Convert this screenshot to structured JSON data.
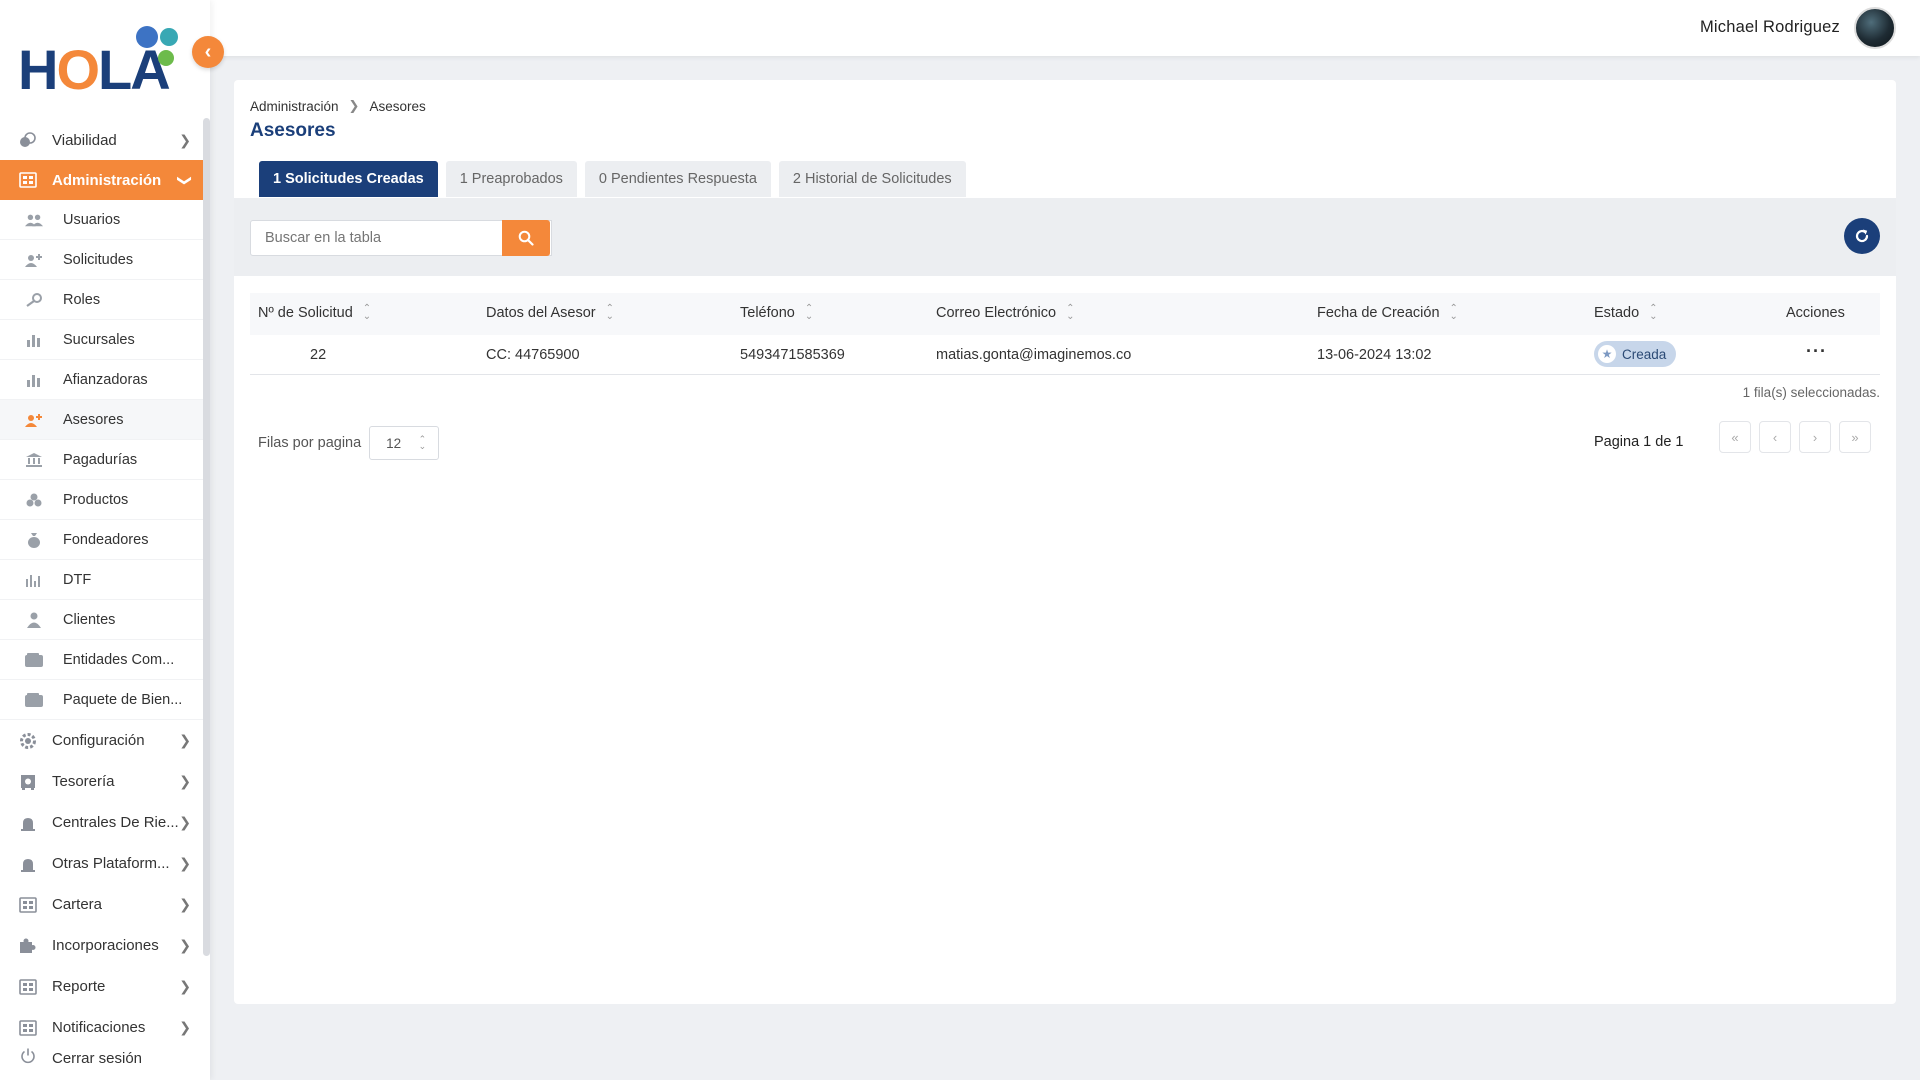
{
  "brand": {
    "logo_text": "HOLA",
    "colors": {
      "primary": "#1b3f7a",
      "accent": "#f4883a",
      "dot_blue": "#3d73c4",
      "dot_teal": "#38a8b4",
      "dot_green": "#6dbb4b"
    }
  },
  "header": {
    "user_name": "Michael Rodriguez"
  },
  "sidebar": {
    "items_top": [
      {
        "label": "Viabilidad",
        "icon": "coins-icon"
      }
    ],
    "active_section": {
      "label": "Administración",
      "icon": "grid-icon"
    },
    "sub_items": [
      {
        "label": "Usuarios",
        "icon": "users-icon"
      },
      {
        "label": "Solicitudes",
        "icon": "user-plus-icon"
      },
      {
        "label": "Roles",
        "icon": "key-icon"
      },
      {
        "label": "Sucursales",
        "icon": "chart-icon"
      },
      {
        "label": "Afianzadoras",
        "icon": "chart-icon"
      },
      {
        "label": "Asesores",
        "icon": "user-plus-icon"
      },
      {
        "label": "Pagadurías",
        "icon": "bank-icon"
      },
      {
        "label": "Productos",
        "icon": "boxes-icon"
      },
      {
        "label": "Fondeadores",
        "icon": "money-bag-icon"
      },
      {
        "label": "DTF",
        "icon": "bars-icon"
      },
      {
        "label": "Clientes",
        "icon": "person-icon"
      },
      {
        "label": "Entidades Com...",
        "icon": "wallet-icon"
      },
      {
        "label": "Paquete de Bien...",
        "icon": "wallet-icon"
      }
    ],
    "items_bottom": [
      {
        "label": "Configuración",
        "icon": "gear-icon"
      },
      {
        "label": "Tesorería",
        "icon": "safe-icon"
      },
      {
        "label": "Centrales De Rie...",
        "icon": "alarm-icon"
      },
      {
        "label": "Otras Plataform...",
        "icon": "alarm-icon"
      },
      {
        "label": "Cartera",
        "icon": "grid-icon"
      },
      {
        "label": "Incorporaciones",
        "icon": "puzzle-icon"
      },
      {
        "label": "Reporte",
        "icon": "grid-icon"
      },
      {
        "label": "Notificaciones",
        "icon": "grid-icon"
      }
    ],
    "logout_label": "Cerrar sesión"
  },
  "breadcrumb": {
    "parent": "Administración",
    "current": "Asesores"
  },
  "page_title": "Asesores",
  "tabs": [
    {
      "label": "1 Solicitudes Creadas",
      "active": true
    },
    {
      "label": "1 Preaprobados",
      "active": false
    },
    {
      "label": "0 Pendientes Respuesta",
      "active": false
    },
    {
      "label": "2 Historial de Solicitudes",
      "active": false
    }
  ],
  "search": {
    "placeholder": "Buscar en la tabla"
  },
  "table": {
    "columns": [
      "Nº de Solicitud",
      "Datos del Asesor",
      "Teléfono",
      "Correo Electrónico",
      "Fecha de Creación",
      "Estado",
      "Acciones"
    ],
    "rows": [
      {
        "id": "22",
        "asesor": "CC: 44765900",
        "telefono": "5493471585369",
        "correo": "matias.gonta@imaginemos.co",
        "fecha": "13-06-2024 13:02",
        "estado": "Creada"
      }
    ],
    "selected_info": "1 fila(s) seleccionadas.",
    "rows_per_page_label": "Filas por pagina",
    "rows_per_page_value": "12",
    "page_info": "Pagina 1 de 1"
  }
}
